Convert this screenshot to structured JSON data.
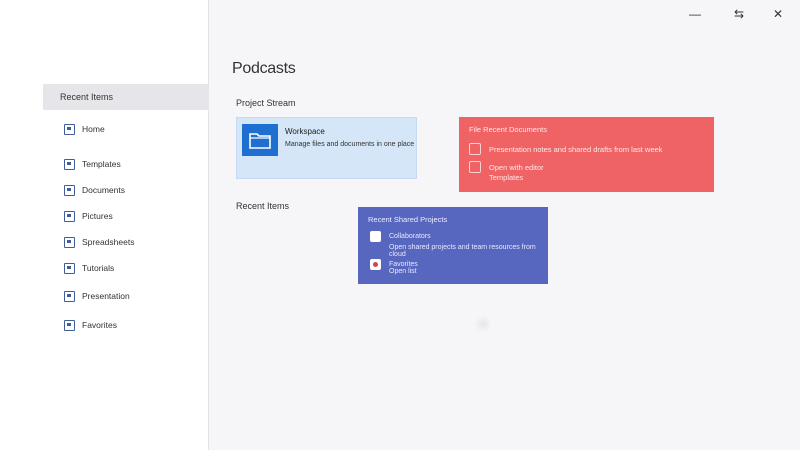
{
  "window": {
    "app_glyph": "⌐",
    "controls": {
      "minimize": "—",
      "restore": "⇆",
      "close": "✕"
    }
  },
  "sidebar": {
    "selected_label": "Recent Items",
    "items": [
      {
        "label": "Home",
        "icon": "folder-icon"
      },
      {
        "label": "Templates",
        "icon": "template-icon"
      },
      {
        "label": "Documents",
        "icon": "document-icon"
      },
      {
        "label": "Pictures",
        "icon": "image-icon"
      },
      {
        "label": "Spreadsheets",
        "icon": "sheet-icon"
      },
      {
        "label": "Tutorials",
        "icon": "image-icon"
      },
      {
        "label": "Presentation",
        "icon": "image-icon"
      },
      {
        "label": "Favorites",
        "icon": "list-icon"
      }
    ]
  },
  "main": {
    "page_title": "Podcasts",
    "section_recent": "Project Stream",
    "section_shared": "Recent Items",
    "blue_card": {
      "title": "Workspace",
      "subtitle": "Manage files and documents in one place",
      "icon": "folder-icon"
    },
    "red_card": {
      "rows": [
        {
          "label": "File   Recent Documents",
          "icon": "info-icon"
        },
        {
          "label": "Presentation notes and shared drafts from last week",
          "icon": "folder-icon"
        },
        {
          "label": "Open with editor",
          "icon": "folder-icon"
        },
        {
          "label": "Templates",
          "icon": "image-icon"
        }
      ]
    },
    "indigo_card": {
      "header": "Recent   Shared Projects",
      "rows": [
        {
          "label": "Collaborators",
          "icon": "doc-icon"
        },
        {
          "label": "Open shared projects and team resources from cloud",
          "icon": "doc-icon"
        },
        {
          "label": "Favorites",
          "icon": "record-icon"
        },
        {
          "label": "Open list",
          "icon": "record-icon"
        }
      ]
    }
  },
  "colors": {
    "accent_blue": "#1e6fd0",
    "card_blue_bg": "#d4e6f8",
    "card_red_bg": "#ef6365",
    "card_indigo_bg": "#5766bf"
  }
}
